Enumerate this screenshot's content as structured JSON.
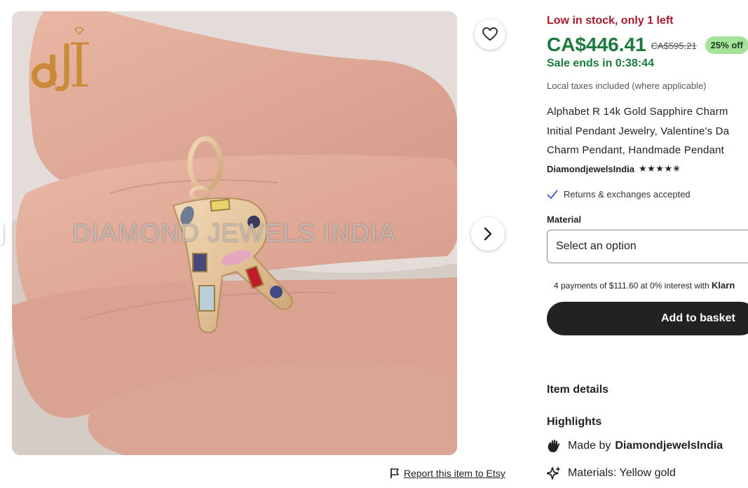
{
  "gallery": {
    "watermark": "DIAMOND JEWELS INDIA",
    "logo_text": "dJI",
    "favorite_icon": "heart-icon",
    "next_icon": "chevron-right-icon"
  },
  "report": {
    "label": "Report this item to Etsy",
    "icon": "flag-icon"
  },
  "listing": {
    "stock_message": "Low in stock, only 1 left",
    "price": "CA$446.41",
    "original_price": "CA$595.21",
    "discount_badge": "25% off",
    "sale_timer": "Sale ends in 0:38:44",
    "tax_note": "Local taxes included (where applicable)",
    "title_lines": [
      "Alphabet R 14k Gold Sapphire Charm",
      "Initial Pendant Jewelry, Valentine's Da",
      "Charm Pendant, Handmade Pendant"
    ],
    "shop_name": "DiamondjewelsIndia",
    "rating_stars": "★★★★✬",
    "returns": "Returns & exchanges accepted",
    "material_label": "Material",
    "material_placeholder": "Select an option",
    "klarna_text": "4 payments of $111.60 at 0% interest with",
    "klarna_brand": "Klarn",
    "add_to_basket": "Add to basket",
    "item_details": "Item details",
    "highlights_title": "Highlights",
    "made_by_prefix": "Made by",
    "made_by_shop": "DiamondjewelsIndia",
    "materials": "Materials: Yellow gold"
  },
  "colors": {
    "stock_red": "#a61a2e",
    "price_green": "#1b7a3c",
    "badge_green": "#a6e39a",
    "button_dark": "#222222"
  }
}
